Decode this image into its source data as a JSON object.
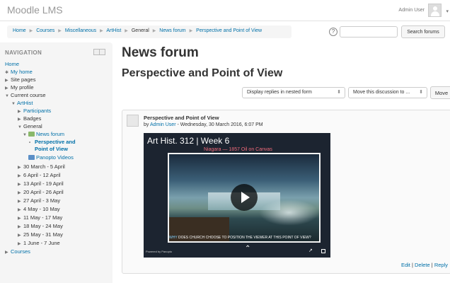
{
  "header": {
    "brand": "Moodle LMS",
    "user_name": "Admin User",
    "menu_caret": "▾"
  },
  "breadcrumb": {
    "items": [
      {
        "label": "Home",
        "link": true
      },
      {
        "label": "Courses",
        "link": true
      },
      {
        "label": "Miscellaneous",
        "link": true
      },
      {
        "label": "ArtHist",
        "link": true
      },
      {
        "label": "General",
        "link": false
      },
      {
        "label": "News forum",
        "link": true
      },
      {
        "label": "Perspective and Point of View",
        "link": true
      }
    ],
    "separator": "▶"
  },
  "search": {
    "help_glyph": "?",
    "placeholder": "",
    "button_label": "Search forums"
  },
  "navigation": {
    "heading": "NAVIGATION",
    "home": "Home",
    "my_home": "My home",
    "site_pages": "Site pages",
    "my_profile": "My profile",
    "current_course": "Current course",
    "course": "ArtHist",
    "participants": "Participants",
    "badges": "Badges",
    "general": "General",
    "news_forum": "News forum",
    "perspective_line1": "Perspective and",
    "perspective_line2": "Point of View",
    "panopto": "Panopto Videos",
    "weeks": [
      "30 March - 5 April",
      "6 April - 12 April",
      "13 April - 19 April",
      "20 April - 26 April",
      "27 April - 3 May",
      "4 May - 10 May",
      "11 May - 17 May",
      "18 May - 24 May",
      "25 May - 31 May",
      "1 June - 7 June"
    ],
    "courses": "Courses"
  },
  "main": {
    "forum_title": "News forum",
    "discussion_title": "Perspective and Point of View",
    "display_mode": "Display replies in nested form",
    "move_select": "Move this discussion to ...",
    "move_button": "Move"
  },
  "post": {
    "subject": "Perspective and Point of View",
    "by_prefix": "by ",
    "author": "Admin User",
    "date": " - Wednesday, 30 March 2016, 6:07 PM",
    "links": {
      "edit": "Edit",
      "sep": " | ",
      "delete": "Delete",
      "reply": "Reply"
    }
  },
  "video": {
    "title": "Art Hist. 312 | Week 6",
    "subtitle": "Niagara — 1857 Oil on Canvas",
    "caption_highlight": "WHY",
    "caption_rest": " DOES CHURCH CHOOSE TO POSITION THE VIEWER AT THIS POINT OF VIEW?",
    "powered": "Powered by Panopto"
  }
}
